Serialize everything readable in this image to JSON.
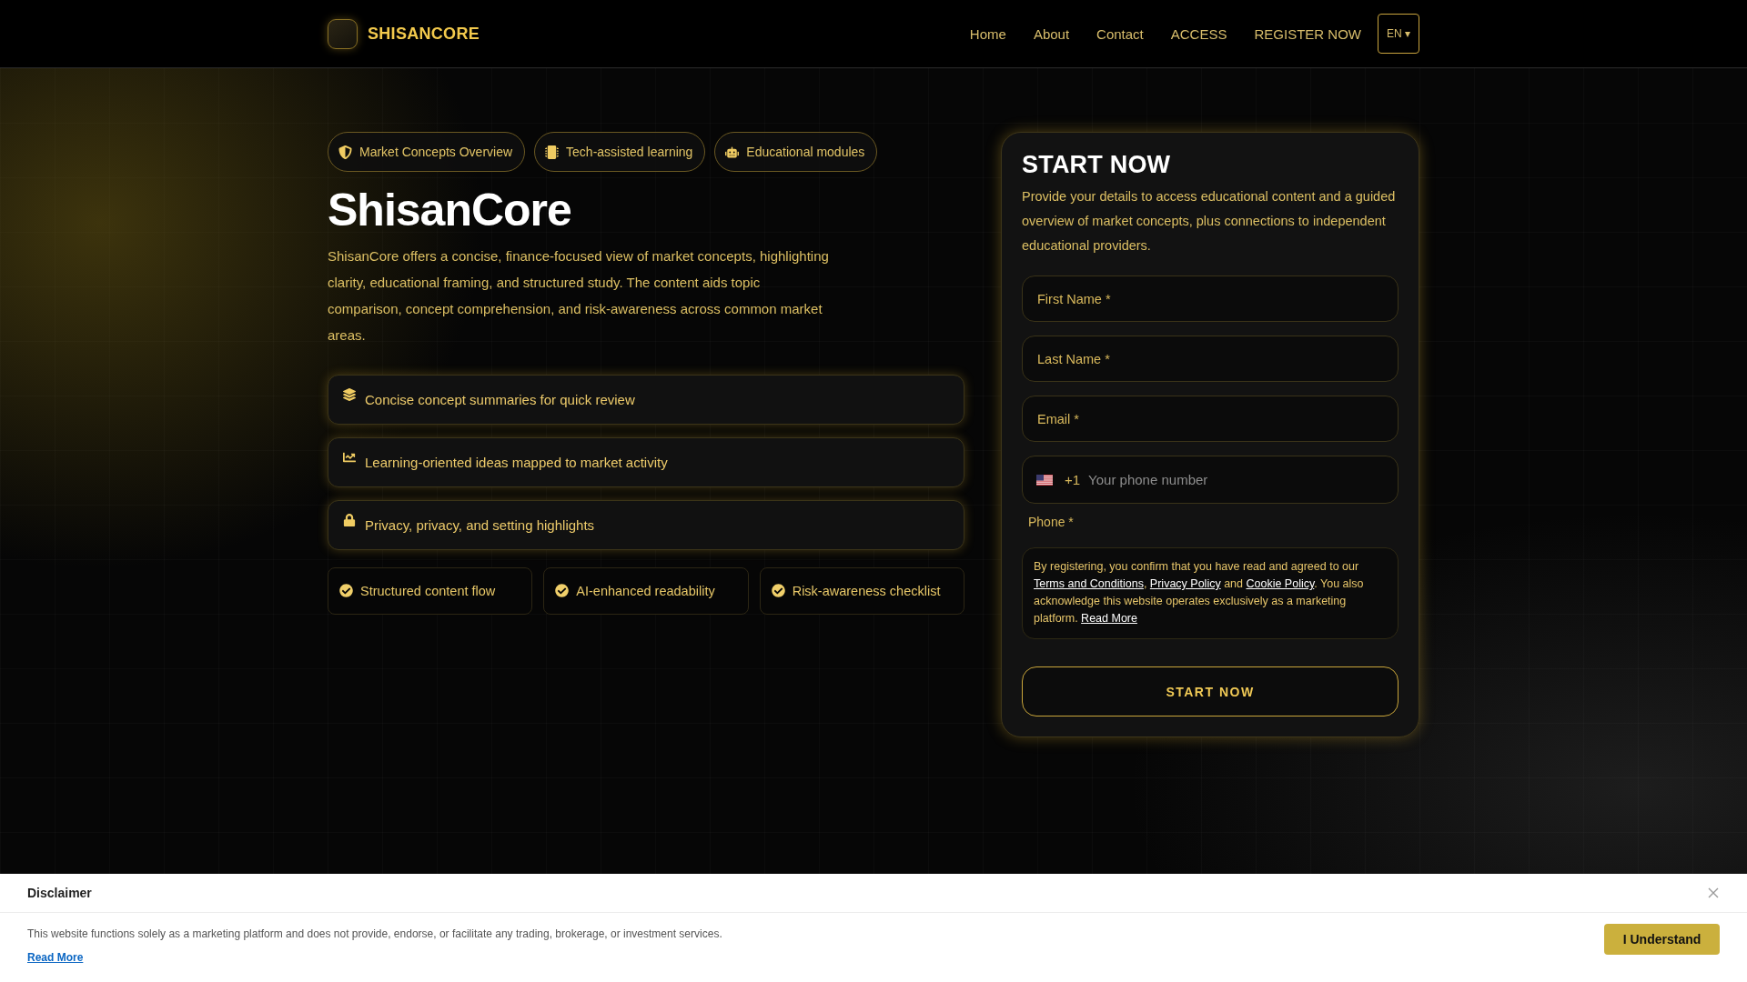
{
  "header": {
    "brand": "SHISANCORE",
    "nav": [
      "Home",
      "About",
      "Contact",
      "ACCESS",
      "REGISTER NOW"
    ],
    "language": "EN ▾"
  },
  "hero": {
    "tags": [
      "Market Concepts Overview",
      "Tech-assisted learning",
      "Educational modules"
    ],
    "title": "ShisanCore",
    "description": "ShisanCore offers a concise, finance-focused view of market concepts, highlighting clarity, educational framing, and structured study. The content aids topic comparison, concept comprehension, and risk-awareness across common market areas.",
    "features": [
      "Concise concept summaries for quick review",
      "Learning-oriented ideas mapped to market activity",
      "Privacy, privacy, and setting highlights"
    ],
    "highlights": [
      "Structured content flow",
      "AI-enhanced readability",
      "Risk-awareness checklist"
    ]
  },
  "form": {
    "title": "START NOW",
    "description": "Provide your details to access educational content and a guided overview of market concepts, plus connections to independent educational providers.",
    "fields": [
      {
        "placeholder": "First Name *"
      },
      {
        "placeholder": "Last Name *"
      },
      {
        "placeholder": "Email *"
      }
    ],
    "phone": {
      "dial_code": "+1",
      "placeholder": "Your phone number",
      "label": "Phone *"
    },
    "consent": [
      {
        "kind": "text",
        "text": "By registering, you confirm that you have read and agreed to our "
      },
      {
        "kind": "link",
        "text": "Terms and Conditions"
      },
      {
        "kind": "text",
        "text": ", "
      },
      {
        "kind": "link",
        "text": "Privacy Policy"
      },
      {
        "kind": "text",
        "text": " and "
      },
      {
        "kind": "link",
        "text": "Cookie Policy"
      },
      {
        "kind": "text",
        "text": ". You also acknowledge this website operates exclusively as a marketing platform. "
      },
      {
        "kind": "link",
        "text": "Read More"
      }
    ],
    "submit": "START NOW"
  },
  "disclaimer": {
    "title": "Disclaimer",
    "text": "This website functions solely as a marketing platform and does not provide, endorse, or facilitate any trading, brokerage, or investment services.",
    "link": "Read More",
    "button": "I Understand"
  }
}
